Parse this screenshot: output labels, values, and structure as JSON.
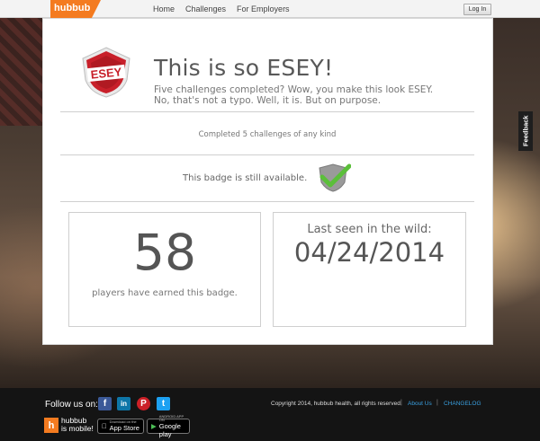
{
  "brand": {
    "name": "hubbub",
    "accent": "#f47b20"
  },
  "nav": {
    "items": [
      "Home",
      "Challenges",
      "For Employers"
    ],
    "login_label": "Log In"
  },
  "badge": {
    "name": "ESEY",
    "title": "This is so ESEY!",
    "description_line1": "Five challenges completed? Wow, you make this look ESEY.",
    "description_line2": "No, that's not a typo. Well, it is. But on purpose.",
    "criteria": "Completed 5 challenges of any kind",
    "availability": "This badge is still available.",
    "icon": "esey-badge-icon",
    "status_icon": "check-badge-icon"
  },
  "stats": {
    "players_count": "58",
    "players_caption": "players have earned this badge.",
    "last_seen_label": "Last seen in the wild:",
    "last_seen_date": "04/24/2014"
  },
  "feedback_label": "Feedback",
  "footer": {
    "follow_label": "Follow us on:",
    "social": [
      {
        "name": "facebook-icon",
        "glyph": "f",
        "color": "#3b5998"
      },
      {
        "name": "linkedin-icon",
        "glyph": "in",
        "color": "#0e76a8"
      },
      {
        "name": "pinterest-icon",
        "glyph": "P",
        "color": "#cb2027"
      },
      {
        "name": "twitter-icon",
        "glyph": "t",
        "color": "#1da1f2"
      }
    ],
    "copyright": "Copyright 2014, hubbub health, all rights reserved.",
    "separator": "|",
    "about_label": "About Us",
    "changelog_label": "CHANGELOG",
    "mobile_line1": "hubbub",
    "mobile_line2": "is mobile!",
    "app_store_small": "Download on the",
    "app_store_label": "App Store",
    "google_play_small": "ANDROID APP ON",
    "google_play_label": "Google play"
  }
}
